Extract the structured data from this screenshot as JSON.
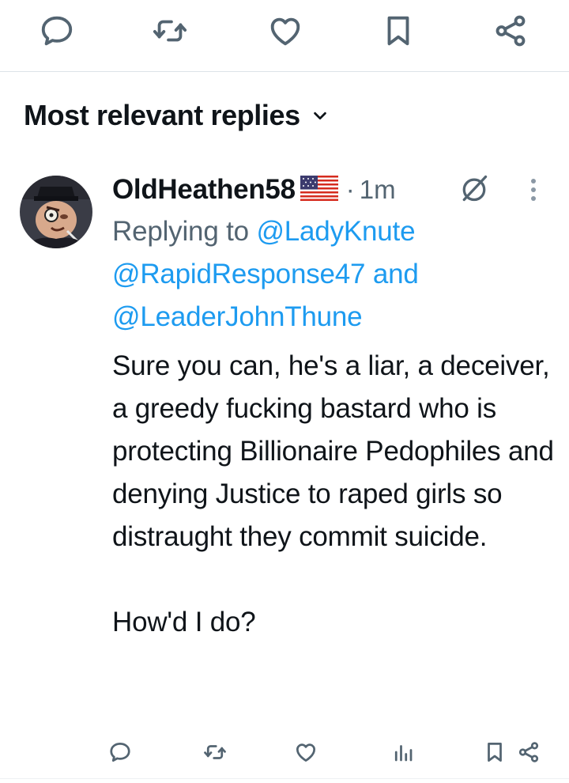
{
  "top_actions": {
    "icons": [
      "reply-icon",
      "retweet-icon",
      "like-icon",
      "bookmark-icon",
      "share-icon"
    ]
  },
  "replies_section": {
    "sort_label": "Most relevant replies"
  },
  "reply": {
    "author_name": "OldHeathen58",
    "author_flag": "US flag",
    "separator": "·",
    "time": "1m",
    "replying_prefix": "Replying to",
    "mentions": [
      "@LadyKnute",
      "@RapidResponse47",
      "@LeaderJohnThune"
    ],
    "mention_joiner": "and",
    "text_paragraph_1": "Sure you can, he's a liar, a deceiver, a greedy fucking bastard who is protecting Billionaire Pedophiles and denying Justice to raped girls so distraught they commit suicide.",
    "text_paragraph_2": "How'd I do?",
    "action_icons": [
      "reply-icon",
      "retweet-icon",
      "like-icon",
      "views-icon",
      "bookmark-icon",
      "share-icon"
    ]
  },
  "colors": {
    "text": "#0f1419",
    "secondary": "#536471",
    "link": "#1d9bf0",
    "divider": "#dde3e8"
  }
}
